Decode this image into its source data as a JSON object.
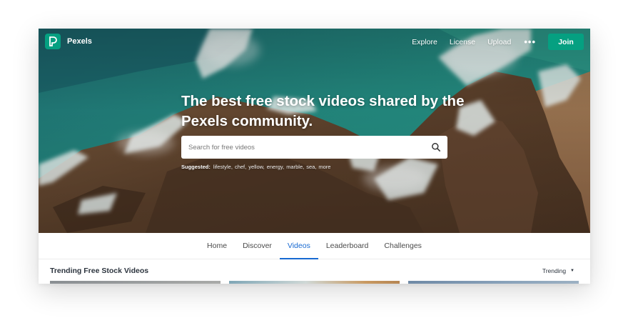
{
  "brand": {
    "name": "Pexels"
  },
  "nav": {
    "links": [
      "Explore",
      "License",
      "Upload"
    ],
    "more": "•••",
    "join_label": "Join"
  },
  "hero": {
    "headline": "The best free stock videos shared by the Pexels community.",
    "search_placeholder": "Search for free videos",
    "suggested_label": "Suggested:",
    "suggested_items": [
      "lifestyle,",
      "chef,",
      "yellow,",
      "energy,",
      "marble,",
      "sea,",
      "more"
    ]
  },
  "tabs": {
    "items": [
      "Home",
      "Discover",
      "Videos",
      "Leaderboard",
      "Challenges"
    ],
    "active": "Videos"
  },
  "section": {
    "title": "Trending Free Stock Videos",
    "sort_label": "Trending"
  },
  "colors": {
    "brand_green": "#05a081",
    "active_tab_blue": "#1769d1",
    "ocean": "#1c7d7b",
    "rock": "#6b4a30"
  },
  "icons": {
    "logo": "pexels-logo-icon",
    "search": "search-icon",
    "sort_caret": "caret-down-icon"
  }
}
